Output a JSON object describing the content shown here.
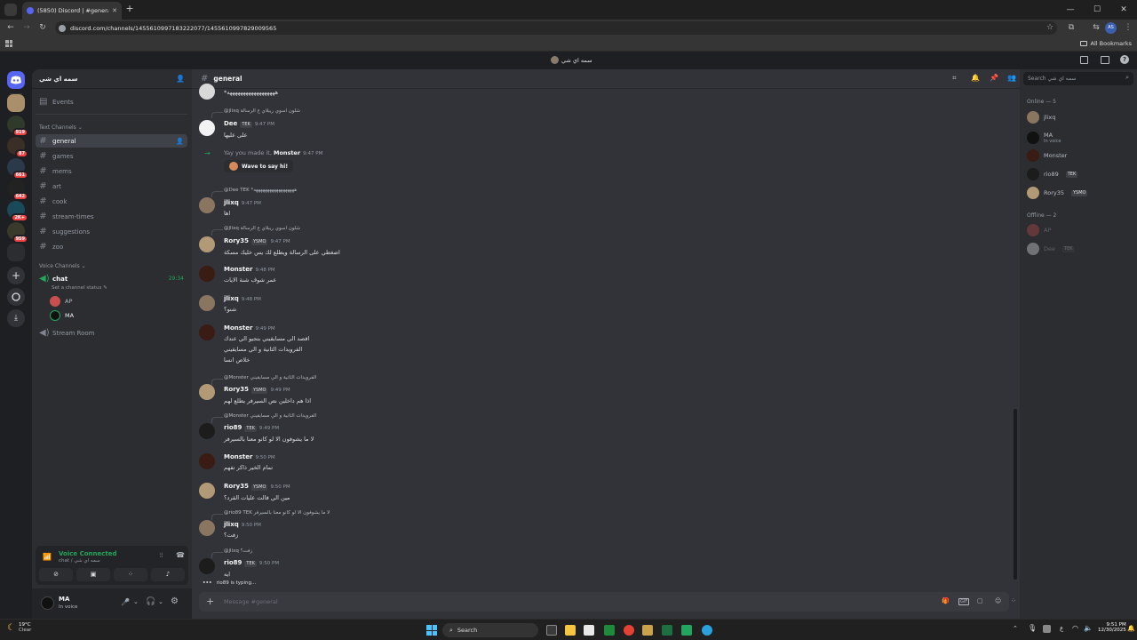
{
  "browser": {
    "tab_title": "(5850) Discord | #general | ...",
    "url": "discord.com/channels/1455610997183222077/1455610997829009565",
    "all_bookmarks": "All Bookmarks",
    "profile_initials": "AS"
  },
  "discord_top": {
    "server_name": "سمه اي شي"
  },
  "rail": {
    "badges": [
      "919",
      "87",
      "661",
      "642",
      "2K+",
      "959"
    ]
  },
  "server": {
    "name": "سمه اي شي",
    "events": "Events",
    "text_category": "Text Channels",
    "text_channels": [
      "general",
      "games",
      "mems",
      "art",
      "cook",
      "stream-times",
      "suggestions",
      "zoo"
    ],
    "voice_category": "Voice Channels",
    "voice_channel": "chat",
    "voice_timer": "29:34",
    "voice_status": "Set a channel status",
    "voice_members": [
      "AP",
      "MA"
    ],
    "stream_room": "Stream Room"
  },
  "voice_panel": {
    "status": "Voice Connected",
    "location": "chat / سمه اي شي"
  },
  "user_panel": {
    "name": "MA",
    "status": "In voice"
  },
  "chat": {
    "channel": "general",
    "composer_placeholder": "Message #general",
    "typing": "rio89 is typing...",
    "top_text": "*ههههههههههههههههههه",
    "messages": [
      {
        "reply": "@jlixq  شلون اسوي ريبلاي ع الرسالة",
        "name": "Dee",
        "tag": "TEK",
        "time": "9:47 PM",
        "text": "على عليها"
      },
      {
        "system_pre": "Yay you made it,",
        "system_name": "Monster",
        "time": "9:47 PM",
        "wave": "Wave to say hi!"
      },
      {
        "reply": "@Dee  TEK  *ههههههههههههههههههه",
        "name": "jlixq",
        "tag": "",
        "time": "9:47 PM",
        "text": "اها"
      },
      {
        "reply": "@jlixq  شلون اسوي ريبلاي ع الرسالة",
        "name": "Rory35",
        "tag": "YSMO",
        "time": "9:47 PM",
        "text": "اضغطي على الرسالة ويطلع لك يس خليك مسكة"
      },
      {
        "reply": "",
        "name": "Monster",
        "tag": "",
        "time": "9:48 PM",
        "text": "عمر شوف شنة الايات"
      },
      {
        "reply": "",
        "name": "jlixq",
        "tag": "",
        "time": "9:48 PM",
        "text": "شنو؟"
      },
      {
        "reply": "",
        "name": "Monster",
        "tag": "",
        "time": "9:49 PM",
        "text": "اقصد الي مسايقيني بتجيو الي عندك",
        "text2": "الفرويدات الثانية و الي مسايقيني",
        "text3": "خلاص انسا"
      },
      {
        "reply": "@Monster  الفرويدات الثانية و الي مسايقيني",
        "name": "Rory35",
        "tag": "YSMO",
        "time": "9:49 PM",
        "text": "اذا هم داخلين نص السيرفر يطلع لهم"
      },
      {
        "reply": "@Monster  الفرويدات الثانية و الي مسايقيني",
        "name": "rio89",
        "tag": "TEK",
        "time": "9:49 PM",
        "text": "لا ما يشوفون الا لو كانو معنا بالسيرفر"
      },
      {
        "reply": "",
        "name": "Monster",
        "tag": "",
        "time": "9:50 PM",
        "text": "تمام الخير ذاكر تفهم"
      },
      {
        "reply": "",
        "name": "Rory35",
        "tag": "YSMO",
        "time": "9:50 PM",
        "text": "مين الي قالت عليات القرد؟"
      },
      {
        "reply": "@rio89  TEK  لا ما يشوفون الا لو كانو معنا بالسيرفر",
        "name": "jlixq",
        "tag": "",
        "time": "9:50 PM",
        "text": "زفت؟"
      },
      {
        "reply": "@jlixq  زفت؟",
        "name": "rio89",
        "tag": "TEK",
        "time": "9:50 PM",
        "text": "ايه"
      }
    ]
  },
  "members": {
    "online_header": "Online — 5",
    "online": [
      {
        "name": "jlixq",
        "tag": "",
        "sub": ""
      },
      {
        "name": "MA",
        "tag": "",
        "sub": "In voice"
      },
      {
        "name": "Monster",
        "tag": "",
        "sub": ""
      },
      {
        "name": "rio89",
        "tag": "TEK",
        "sub": ""
      },
      {
        "name": "Rory35",
        "tag": "YSMO",
        "sub": ""
      }
    ],
    "offline_header": "Offline — 2",
    "offline": [
      {
        "name": "AP",
        "tag": ""
      },
      {
        "name": "Dee",
        "tag": "TEK"
      }
    ],
    "search_placeholder": "Search سمه اي شي"
  },
  "taskbar": {
    "weather_temp": "19°C",
    "weather_desc": "Clear",
    "search_label": "Search",
    "lang": "ع",
    "time": "9:51 PM",
    "date": "12/30/2025"
  },
  "colors": {
    "discord_blurple": "#5865f2",
    "online_green": "#23a55a",
    "danger_red": "#f23f42"
  }
}
